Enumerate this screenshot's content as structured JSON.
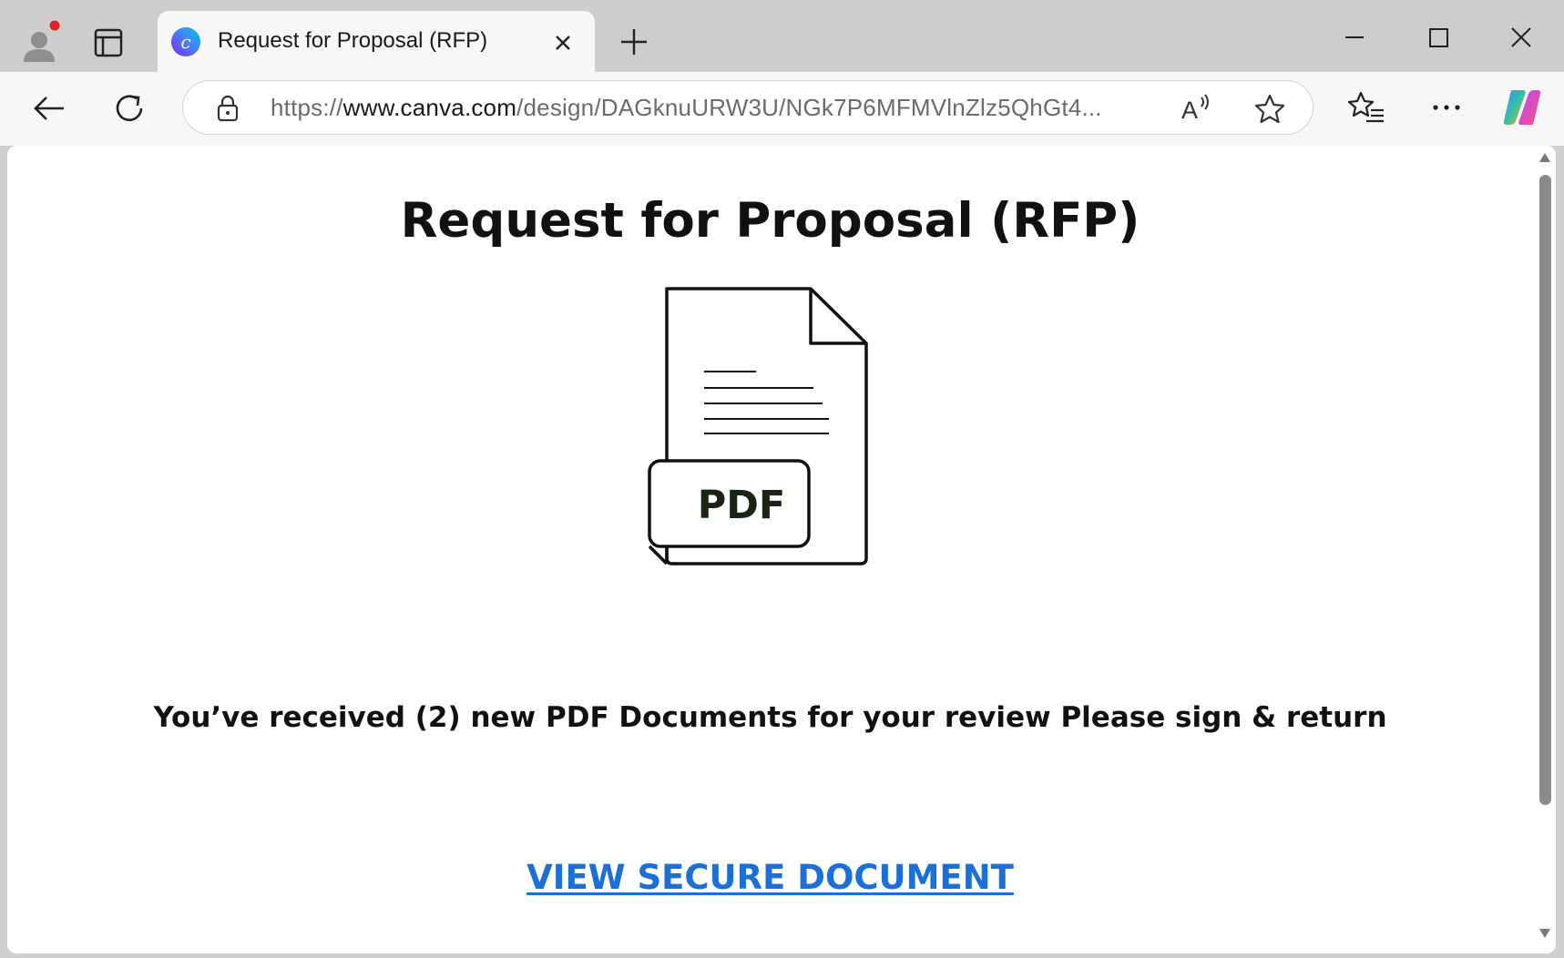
{
  "browser": {
    "tab": {
      "title": "Request for Proposal (RFP)",
      "favicon": "canva-icon"
    },
    "address_bar": {
      "url_prefix": "https://",
      "url_host": "www.canva.com",
      "url_path": "/design/DAGknuURW3U/NGk7P6MFMVlnZlz5QhGt4..."
    },
    "icons": {
      "profile": "profile-icon",
      "tab_actions": "tab-actions-icon",
      "close_tab": "close-icon",
      "new_tab": "plus-icon",
      "minimize": "minimize-icon",
      "maximize": "maximize-icon",
      "close_window": "close-icon",
      "back": "back-arrow-icon",
      "reload": "reload-icon",
      "lock": "lock-icon",
      "read_aloud": "read-aloud-icon",
      "add_favorite": "star-icon",
      "favorites": "favorites-icon",
      "more": "more-icon",
      "copilot": "copilot-icon"
    }
  },
  "page": {
    "heading": "Request for Proposal (RFP)",
    "pdf_icon_label": "PDF",
    "message": "You’ve received (2) new PDF Documents for your review Please sign & return",
    "cta_label": "VIEW SECURE DOCUMENT"
  },
  "colors": {
    "link": "#1b6fd8",
    "heading": "#111111",
    "tabstrip": "#cdcdcd",
    "toolbar": "#f7f7f7"
  }
}
